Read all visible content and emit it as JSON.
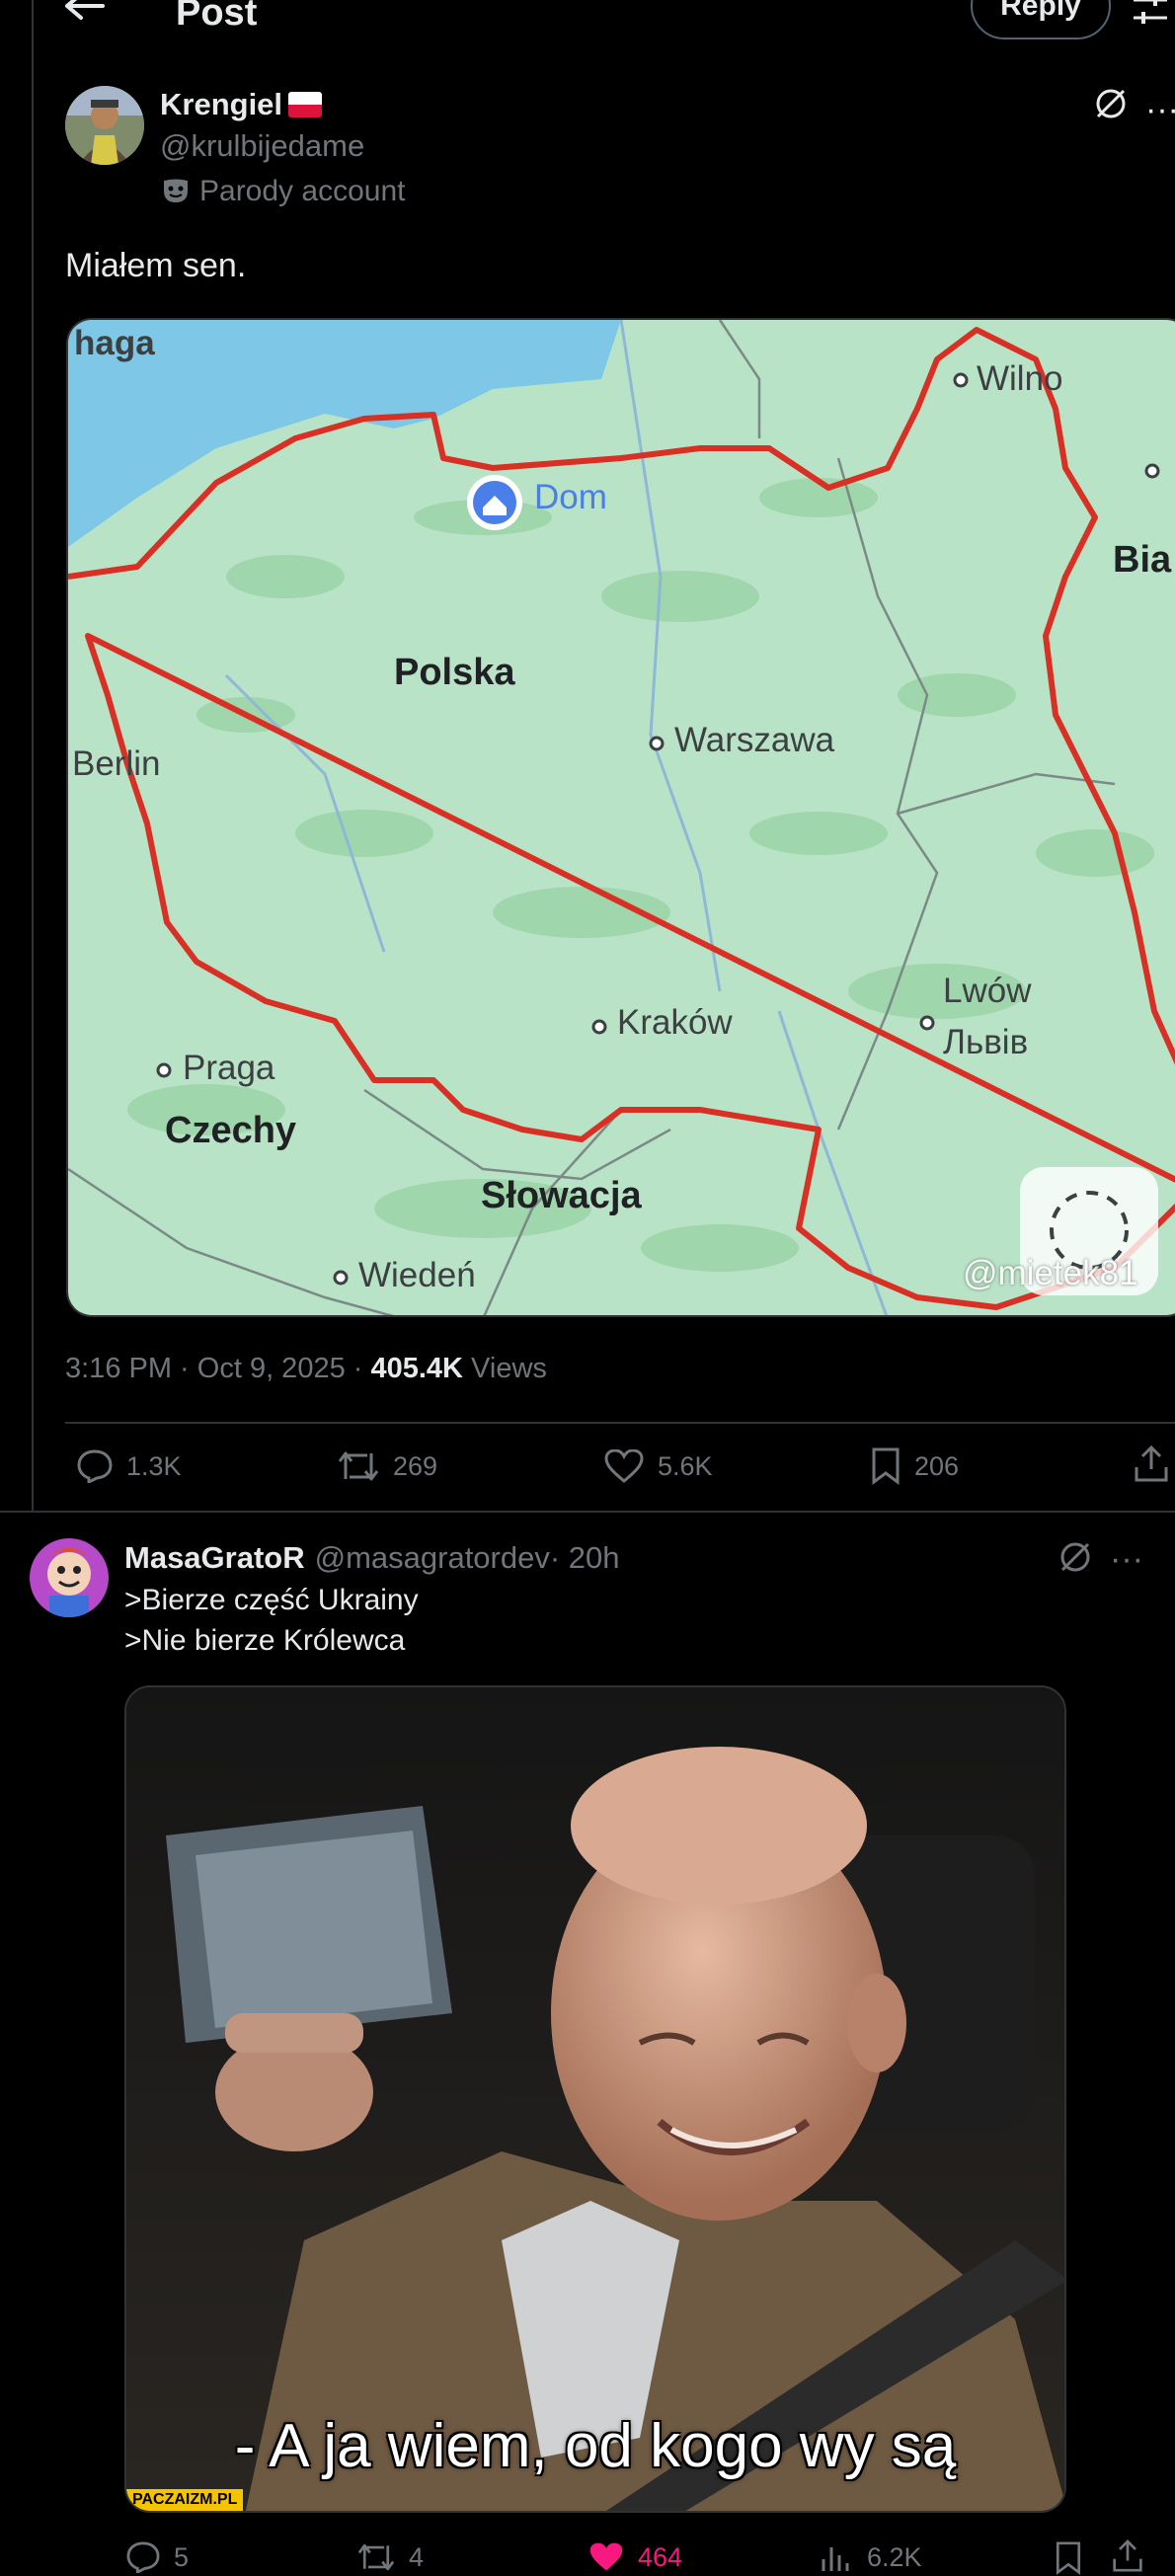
{
  "header": {
    "title": "Post",
    "reply_label": "Reply"
  },
  "post": {
    "name": "Krengiel",
    "handle": "@krulbijedame",
    "label": "Parody account",
    "text": "Miałem sen.",
    "timestamp": "3:16 PM · Oct 9, 2025 · ",
    "views_count": "405.4K",
    "views_label": " Views",
    "replies": "1.3K",
    "reposts": "269",
    "likes": "5.6K",
    "bookmarks": "206",
    "map": {
      "labels": {
        "haga": "haga",
        "wilno": "Wilno",
        "dom": "Dom",
        "bia": "Bia",
        "polska": "Polska",
        "berlin": "Berlin",
        "warszawa": "Warszawa",
        "lwow": "Lwów",
        "lviv": "Львів",
        "krakow": "Kraków",
        "praga": "Praga",
        "czechy": "Czechy",
        "slowacja": "Słowacja",
        "wieden": "Wiedeń",
        "tiktok": "@mietek81"
      }
    }
  },
  "reply": {
    "name": "MasaGratoR",
    "handle": "@masagratordev",
    "time": " · 20h",
    "line1": ">Bierze część Ukrainy",
    "line2": ">Nie bierze Królewca",
    "caption": "- A ja wiem, od kogo wy są",
    "watermark": "PACZAIZM.PL",
    "replies": "5",
    "reposts": "4",
    "likes": "464",
    "views": "6.2K"
  },
  "colors": {
    "accent_like": "#f91880",
    "muted": "#71767b",
    "border_red": "#d93025"
  }
}
